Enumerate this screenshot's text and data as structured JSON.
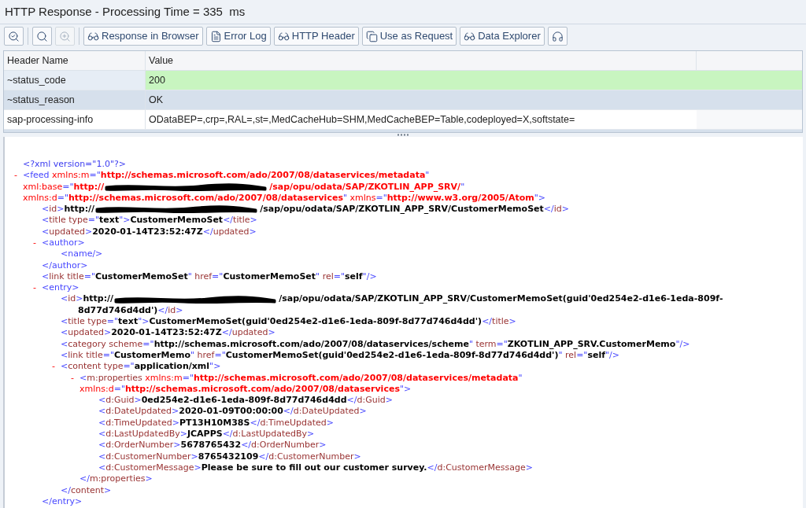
{
  "window": {
    "title": "HTTP Response - Processing Time = 335  ms"
  },
  "toolbar": {
    "groups": [
      [
        {
          "disabled": false
        }
      ],
      [
        {
          "disabled": false
        },
        {
          "disabled": true
        }
      ],
      [
        {
          "label": "Response in Browser",
          "disabled": false
        },
        {
          "label": "Error Log",
          "disabled": false
        },
        {
          "label": "HTTP Header",
          "disabled": false
        },
        {
          "label": "Use as Request",
          "disabled": false
        },
        {
          "label": "Data Explorer",
          "disabled": false
        },
        {
          "disabled": false
        }
      ]
    ]
  },
  "header_table": {
    "columns": [
      "Header Name",
      "Value"
    ],
    "rows": [
      {
        "name": "~status_code",
        "value": "200",
        "kind": "success"
      },
      {
        "name": "~status_reason",
        "value": "OK",
        "kind": "shaded"
      },
      {
        "name": "sap-processing-info",
        "value": "ODataBEP=,crp=,RAL=,st=,MedCacheHub=SHM,MedCacheBEP=Table,codeployed=X,softstate=",
        "kind": "plain"
      }
    ]
  },
  "xml_view": {
    "nodes": [
      {
        "lines": [
          [
            {
              "kind": "decl",
              "text": "<?xml version=\"1.0\"?>"
            }
          ]
        ]
      },
      {
        "toggle": "-",
        "lines": [
          [
            {
              "kind": "punct",
              "text": "<feed"
            },
            {
              "kind": "ns-name",
              "text": " xmlns:m"
            },
            {
              "kind": "punct",
              "text": "=\""
            },
            {
              "kind": "ns-value",
              "text": "http://schemas.microsoft.com/ado/2007/08/dataservices/metadata"
            },
            {
              "kind": "punct",
              "text": "\""
            }
          ],
          [
            {
              "kind": "ns-name",
              "text": "xml:base"
            },
            {
              "kind": "punct",
              "text": "=\""
            },
            {
              "kind": "ns-value",
              "text": "http://"
            },
            {
              "kind": "redacted"
            },
            {
              "kind": "ns-value",
              "text": "/sap/opu/odata/SAP/ZKOTLIN_APP_SRV/"
            },
            {
              "kind": "punct",
              "text": "\""
            }
          ],
          [
            {
              "kind": "ns-name",
              "text": "xmlns:d"
            },
            {
              "kind": "punct",
              "text": "=\""
            },
            {
              "kind": "ns-value",
              "text": "http://schemas.microsoft.com/ado/2007/08/dataservices"
            },
            {
              "kind": "punct",
              "text": "\""
            },
            {
              "kind": "ns-name",
              "text": " xmlns"
            },
            {
              "kind": "punct",
              "text": "=\""
            },
            {
              "kind": "ns-value",
              "text": "http://www.w3.org/2005/Atom"
            },
            {
              "kind": "punct",
              "text": "\">"
            }
          ]
        ],
        "children": [
          {
            "lines": [
              [
                {
                  "kind": "punct",
                  "text": "<"
                },
                {
                  "kind": "name",
                  "text": "id"
                },
                {
                  "kind": "punct",
                  "text": ">"
                },
                {
                  "kind": "value",
                  "text": "http://"
                },
                {
                  "kind": "redacted"
                },
                {
                  "kind": "value",
                  "text": "/sap/opu/odata/SAP/ZKOTLIN_APP_SRV/CustomerMemoSet"
                },
                {
                  "kind": "punct",
                  "text": "</"
                },
                {
                  "kind": "name",
                  "text": "id"
                },
                {
                  "kind": "punct",
                  "text": ">"
                }
              ]
            ]
          },
          {
            "lines": [
              [
                {
                  "kind": "punct",
                  "text": "<"
                },
                {
                  "kind": "name",
                  "text": "title type"
                },
                {
                  "kind": "punct",
                  "text": "=\""
                },
                {
                  "kind": "value",
                  "text": "text"
                },
                {
                  "kind": "punct",
                  "text": "\">"
                },
                {
                  "kind": "value",
                  "text": "CustomerMemoSet"
                },
                {
                  "kind": "punct",
                  "text": "</"
                },
                {
                  "kind": "name",
                  "text": "title"
                },
                {
                  "kind": "punct",
                  "text": ">"
                }
              ]
            ]
          },
          {
            "lines": [
              [
                {
                  "kind": "punct",
                  "text": "<"
                },
                {
                  "kind": "name",
                  "text": "updated"
                },
                {
                  "kind": "punct",
                  "text": ">"
                },
                {
                  "kind": "value",
                  "text": "2020-01-14T23:52:47Z"
                },
                {
                  "kind": "punct",
                  "text": "</"
                },
                {
                  "kind": "name",
                  "text": "updated"
                },
                {
                  "kind": "punct",
                  "text": ">"
                }
              ]
            ]
          },
          {
            "toggle": "-",
            "lines": [
              [
                {
                  "kind": "punct",
                  "text": "<author>"
                }
              ]
            ],
            "children": [
              {
                "lines": [
                  [
                    {
                      "kind": "punct",
                      "text": "<name/>"
                    }
                  ]
                ]
              }
            ],
            "close": [
              {
                "kind": "punct",
                "text": "</author>"
              }
            ]
          },
          {
            "lines": [
              [
                {
                  "kind": "punct",
                  "text": "<"
                },
                {
                  "kind": "name",
                  "text": "link title"
                },
                {
                  "kind": "punct",
                  "text": "=\""
                },
                {
                  "kind": "value",
                  "text": "CustomerMemoSet"
                },
                {
                  "kind": "punct",
                  "text": "\""
                },
                {
                  "kind": "name",
                  "text": " href"
                },
                {
                  "kind": "punct",
                  "text": "=\""
                },
                {
                  "kind": "value",
                  "text": "CustomerMemoSet"
                },
                {
                  "kind": "punct",
                  "text": "\""
                },
                {
                  "kind": "name",
                  "text": " rel"
                },
                {
                  "kind": "punct",
                  "text": "=\""
                },
                {
                  "kind": "value",
                  "text": "self"
                },
                {
                  "kind": "punct",
                  "text": "\"/>"
                }
              ]
            ]
          },
          {
            "toggle": "-",
            "lines": [
              [
                {
                  "kind": "punct",
                  "text": "<entry>"
                }
              ]
            ],
            "children": [
              {
                "hanging": true,
                "lines": [
                  [
                    {
                      "kind": "punct",
                      "text": "<"
                    },
                    {
                      "kind": "name",
                      "text": "id"
                    },
                    {
                      "kind": "punct",
                      "text": ">"
                    },
                    {
                      "kind": "value",
                      "text": "http://"
                    },
                    {
                      "kind": "redacted"
                    },
                    {
                      "kind": "value",
                      "text": "/sap/opu/odata/SAP/ZKOTLIN_APP_SRV/CustomerMemoSet(guid'0ed254e2-d1e6-1eda-809f-"
                    }
                  ],
                  [
                    {
                      "kind": "value",
                      "text": "8d77d746d4dd')"
                    },
                    {
                      "kind": "punct",
                      "text": "</"
                    },
                    {
                      "kind": "name",
                      "text": "id"
                    },
                    {
                      "kind": "punct",
                      "text": ">"
                    }
                  ]
                ]
              },
              {
                "lines": [
                  [
                    {
                      "kind": "punct",
                      "text": "<"
                    },
                    {
                      "kind": "name",
                      "text": "title type"
                    },
                    {
                      "kind": "punct",
                      "text": "=\""
                    },
                    {
                      "kind": "value",
                      "text": "text"
                    },
                    {
                      "kind": "punct",
                      "text": "\">"
                    },
                    {
                      "kind": "value",
                      "text": "CustomerMemoSet(guid'0ed254e2-d1e6-1eda-809f-8d77d746d4dd')"
                    },
                    {
                      "kind": "punct",
                      "text": "</"
                    },
                    {
                      "kind": "name",
                      "text": "title"
                    },
                    {
                      "kind": "punct",
                      "text": ">"
                    }
                  ]
                ]
              },
              {
                "lines": [
                  [
                    {
                      "kind": "punct",
                      "text": "<"
                    },
                    {
                      "kind": "name",
                      "text": "updated"
                    },
                    {
                      "kind": "punct",
                      "text": ">"
                    },
                    {
                      "kind": "value",
                      "text": "2020-01-14T23:52:47Z"
                    },
                    {
                      "kind": "punct",
                      "text": "</"
                    },
                    {
                      "kind": "name",
                      "text": "updated"
                    },
                    {
                      "kind": "punct",
                      "text": ">"
                    }
                  ]
                ]
              },
              {
                "lines": [
                  [
                    {
                      "kind": "punct",
                      "text": "<"
                    },
                    {
                      "kind": "name",
                      "text": "category scheme"
                    },
                    {
                      "kind": "punct",
                      "text": "=\""
                    },
                    {
                      "kind": "value",
                      "text": "http://schemas.microsoft.com/ado/2007/08/dataservices/scheme"
                    },
                    {
                      "kind": "punct",
                      "text": "\""
                    },
                    {
                      "kind": "name",
                      "text": " term"
                    },
                    {
                      "kind": "punct",
                      "text": "=\""
                    },
                    {
                      "kind": "value",
                      "text": "ZKOTLIN_APP_SRV.CustomerMemo"
                    },
                    {
                      "kind": "punct",
                      "text": "\"/>"
                    }
                  ]
                ]
              },
              {
                "lines": [
                  [
                    {
                      "kind": "punct",
                      "text": "<"
                    },
                    {
                      "kind": "name",
                      "text": "link title"
                    },
                    {
                      "kind": "punct",
                      "text": "=\""
                    },
                    {
                      "kind": "value",
                      "text": "CustomerMemo"
                    },
                    {
                      "kind": "punct",
                      "text": "\""
                    },
                    {
                      "kind": "name",
                      "text": " href"
                    },
                    {
                      "kind": "punct",
                      "text": "=\""
                    },
                    {
                      "kind": "value",
                      "text": "CustomerMemoSet(guid'0ed254e2-d1e6-1eda-809f-8d77d746d4dd')"
                    },
                    {
                      "kind": "punct",
                      "text": "\""
                    },
                    {
                      "kind": "name",
                      "text": " rel"
                    },
                    {
                      "kind": "punct",
                      "text": "=\""
                    },
                    {
                      "kind": "value",
                      "text": "self"
                    },
                    {
                      "kind": "punct",
                      "text": "\"/>"
                    }
                  ]
                ]
              },
              {
                "toggle": "-",
                "lines": [
                  [
                    {
                      "kind": "punct",
                      "text": "<"
                    },
                    {
                      "kind": "name",
                      "text": "content type"
                    },
                    {
                      "kind": "punct",
                      "text": "=\""
                    },
                    {
                      "kind": "value",
                      "text": "application/xml"
                    },
                    {
                      "kind": "punct",
                      "text": "\">"
                    }
                  ]
                ],
                "children": [
                  {
                    "toggle": "-",
                    "lines": [
                      [
                        {
                          "kind": "punct",
                          "text": "<"
                        },
                        {
                          "kind": "name",
                          "text": "m:properties"
                        },
                        {
                          "kind": "ns-name",
                          "text": " xmlns:m"
                        },
                        {
                          "kind": "punct",
                          "text": "=\""
                        },
                        {
                          "kind": "ns-value",
                          "text": "http://schemas.microsoft.com/ado/2007/08/dataservices/metadata"
                        },
                        {
                          "kind": "punct",
                          "text": "\""
                        }
                      ],
                      [
                        {
                          "kind": "ns-name",
                          "text": "xmlns:d"
                        },
                        {
                          "kind": "punct",
                          "text": "=\""
                        },
                        {
                          "kind": "ns-value",
                          "text": "http://schemas.microsoft.com/ado/2007/08/dataservices"
                        },
                        {
                          "kind": "punct",
                          "text": "\">"
                        }
                      ]
                    ],
                    "children": [
                      {
                        "lines": [
                          [
                            {
                              "kind": "punct",
                              "text": "<"
                            },
                            {
                              "kind": "name",
                              "text": "d:Guid"
                            },
                            {
                              "kind": "punct",
                              "text": ">"
                            },
                            {
                              "kind": "value",
                              "text": "0ed254e2-d1e6-1eda-809f-8d77d746d4dd"
                            },
                            {
                              "kind": "punct",
                              "text": "</"
                            },
                            {
                              "kind": "name",
                              "text": "d:Guid"
                            },
                            {
                              "kind": "punct",
                              "text": ">"
                            }
                          ]
                        ]
                      },
                      {
                        "lines": [
                          [
                            {
                              "kind": "punct",
                              "text": "<"
                            },
                            {
                              "kind": "name",
                              "text": "d:DateUpdated"
                            },
                            {
                              "kind": "punct",
                              "text": ">"
                            },
                            {
                              "kind": "value",
                              "text": "2020-01-09T00:00:00"
                            },
                            {
                              "kind": "punct",
                              "text": "</"
                            },
                            {
                              "kind": "name",
                              "text": "d:DateUpdated"
                            },
                            {
                              "kind": "punct",
                              "text": ">"
                            }
                          ]
                        ]
                      },
                      {
                        "lines": [
                          [
                            {
                              "kind": "punct",
                              "text": "<"
                            },
                            {
                              "kind": "name",
                              "text": "d:TimeUpdated"
                            },
                            {
                              "kind": "punct",
                              "text": ">"
                            },
                            {
                              "kind": "value",
                              "text": "PT13H10M38S"
                            },
                            {
                              "kind": "punct",
                              "text": "</"
                            },
                            {
                              "kind": "name",
                              "text": "d:TimeUpdated"
                            },
                            {
                              "kind": "punct",
                              "text": ">"
                            }
                          ]
                        ]
                      },
                      {
                        "lines": [
                          [
                            {
                              "kind": "punct",
                              "text": "<"
                            },
                            {
                              "kind": "name",
                              "text": "d:LastUpdatedBy"
                            },
                            {
                              "kind": "punct",
                              "text": ">"
                            },
                            {
                              "kind": "value",
                              "text": "JCAPPS"
                            },
                            {
                              "kind": "punct",
                              "text": "</"
                            },
                            {
                              "kind": "name",
                              "text": "d:LastUpdatedBy"
                            },
                            {
                              "kind": "punct",
                              "text": ">"
                            }
                          ]
                        ]
                      },
                      {
                        "lines": [
                          [
                            {
                              "kind": "punct",
                              "text": "<"
                            },
                            {
                              "kind": "name",
                              "text": "d:OrderNumber"
                            },
                            {
                              "kind": "punct",
                              "text": ">"
                            },
                            {
                              "kind": "value",
                              "text": "5678765432"
                            },
                            {
                              "kind": "punct",
                              "text": "</"
                            },
                            {
                              "kind": "name",
                              "text": "d:OrderNumber"
                            },
                            {
                              "kind": "punct",
                              "text": ">"
                            }
                          ]
                        ]
                      },
                      {
                        "lines": [
                          [
                            {
                              "kind": "punct",
                              "text": "<"
                            },
                            {
                              "kind": "name",
                              "text": "d:CustomerNumber"
                            },
                            {
                              "kind": "punct",
                              "text": ">"
                            },
                            {
                              "kind": "value",
                              "text": "8765432109"
                            },
                            {
                              "kind": "punct",
                              "text": "</"
                            },
                            {
                              "kind": "name",
                              "text": "d:CustomerNumber"
                            },
                            {
                              "kind": "punct",
                              "text": ">"
                            }
                          ]
                        ]
                      },
                      {
                        "lines": [
                          [
                            {
                              "kind": "punct",
                              "text": "<"
                            },
                            {
                              "kind": "name",
                              "text": "d:CustomerMessage"
                            },
                            {
                              "kind": "punct",
                              "text": ">"
                            },
                            {
                              "kind": "value",
                              "text": "Please be sure to fill out our customer survey."
                            },
                            {
                              "kind": "punct",
                              "text": "</"
                            },
                            {
                              "kind": "name",
                              "text": "d:CustomerMessage"
                            },
                            {
                              "kind": "punct",
                              "text": ">"
                            }
                          ]
                        ]
                      }
                    ],
                    "close": [
                      {
                        "kind": "punct",
                        "text": "</"
                      },
                      {
                        "kind": "name",
                        "text": "m:properties"
                      },
                      {
                        "kind": "punct",
                        "text": ">"
                      }
                    ]
                  }
                ],
                "close": [
                  {
                    "kind": "punct",
                    "text": "</"
                  },
                  {
                    "kind": "name",
                    "text": "content"
                  },
                  {
                    "kind": "punct",
                    "text": ">"
                  }
                ]
              }
            ],
            "close": [
              {
                "kind": "punct",
                "text": "</entry>"
              }
            ]
          }
        ]
      }
    ]
  }
}
